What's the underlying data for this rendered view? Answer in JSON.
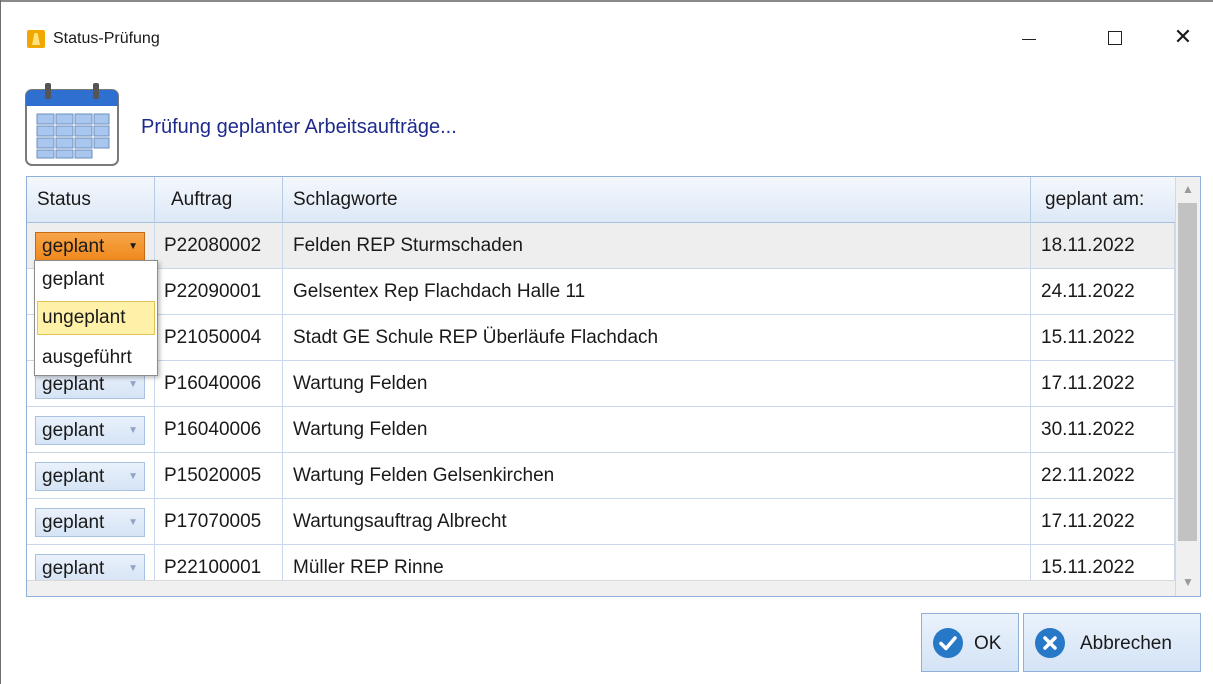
{
  "window": {
    "title": "Status-Prüfung",
    "controls": {
      "minimize": "minimize",
      "maximize": "maximize",
      "close": "close"
    }
  },
  "header": {
    "icon": "calendar-icon",
    "text": "Prüfung geplanter Arbeitsaufträge..."
  },
  "grid": {
    "columns": [
      "Status",
      "Auftrag",
      "Schlagworte",
      "geplant am:"
    ],
    "rows": [
      {
        "status": "geplant",
        "auftrag": "P22080002",
        "schlagworte": "Felden REP Sturmschaden",
        "geplant_am": "18.11.2022"
      },
      {
        "status": "",
        "auftrag": "P22090001",
        "schlagworte": "Gelsentex Rep Flachdach Halle 11",
        "geplant_am": "24.11.2022"
      },
      {
        "status": "",
        "auftrag": "P21050004",
        "schlagworte": "Stadt GE Schule REP Überläufe Flachdach",
        "geplant_am": "15.11.2022"
      },
      {
        "status": "geplant",
        "auftrag": "P16040006",
        "schlagworte": "Wartung Felden",
        "geplant_am": "17.11.2022"
      },
      {
        "status": "geplant",
        "auftrag": "P16040006",
        "schlagworte": "Wartung Felden",
        "geplant_am": "30.11.2022"
      },
      {
        "status": "geplant",
        "auftrag": "P15020005",
        "schlagworte": "Wartung Felden Gelsenkirchen",
        "geplant_am": "22.11.2022"
      },
      {
        "status": "geplant",
        "auftrag": "P17070005",
        "schlagworte": "Wartungsauftrag Albrecht",
        "geplant_am": "17.11.2022"
      },
      {
        "status": "geplant",
        "auftrag": "P22100001",
        "schlagworte": "Müller REP Rinne",
        "geplant_am": "15.11.2022"
      }
    ]
  },
  "dropdown": {
    "options": [
      "geplant",
      "ungeplant",
      "ausgeführt"
    ],
    "highlighted": "ungeplant"
  },
  "buttons": {
    "ok": "OK",
    "cancel": "Abbrechen"
  },
  "colors": {
    "heading": "#1e2b8c",
    "active_combo": "#f08a1c",
    "highlight": "#fff2a8",
    "button_icon": "#2878c8"
  }
}
